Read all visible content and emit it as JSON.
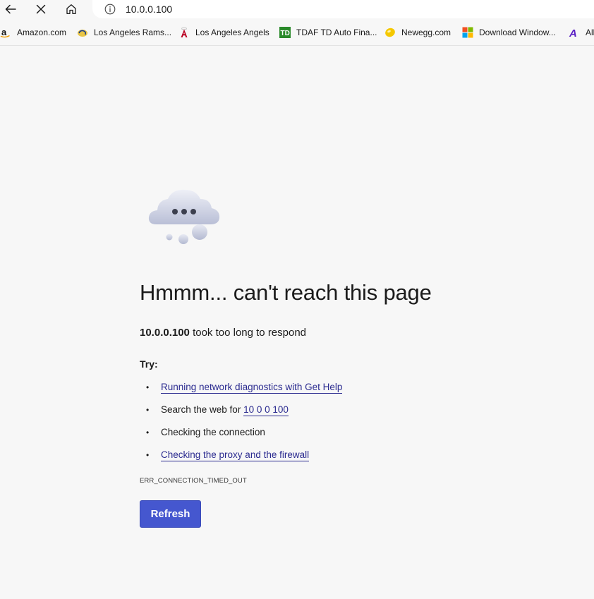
{
  "address_bar": {
    "url": "10.0.0.100"
  },
  "nav": {
    "back_icon": "back-arrow-icon",
    "stop_icon": "close-icon",
    "home_icon": "home-icon",
    "info_icon": "info-icon"
  },
  "bookmarks": [
    {
      "label": "Amazon.com",
      "icon": "amazon-icon"
    },
    {
      "label": "Los Angeles Rams...",
      "icon": "rams-icon"
    },
    {
      "label": "Los Angeles Angels",
      "icon": "angels-icon"
    },
    {
      "label": "TDAF TD Auto Fina...",
      "icon": "td-icon"
    },
    {
      "label": "Newegg.com",
      "icon": "newegg-icon"
    },
    {
      "label": "Download Window...",
      "icon": "windows-icon"
    },
    {
      "label": "All",
      "icon": "all-icon"
    }
  ],
  "error": {
    "heading": "Hmmm... can't reach this page",
    "host": "10.0.0.100",
    "message": " took too long to respond",
    "try_label": "Try:",
    "suggestions": {
      "diagnostics": "Running network diagnostics with Get Help",
      "search_prefix": "Search the web for ",
      "search_link": "10 0 0 100",
      "connection": "Checking the connection",
      "proxy": "Checking the proxy and the firewall"
    },
    "code": "ERR_CONNECTION_TIMED_OUT",
    "refresh_label": "Refresh"
  },
  "colors": {
    "page_bg": "#f7f7f7",
    "link": "#2a2a8f",
    "button": "#4557cf"
  }
}
